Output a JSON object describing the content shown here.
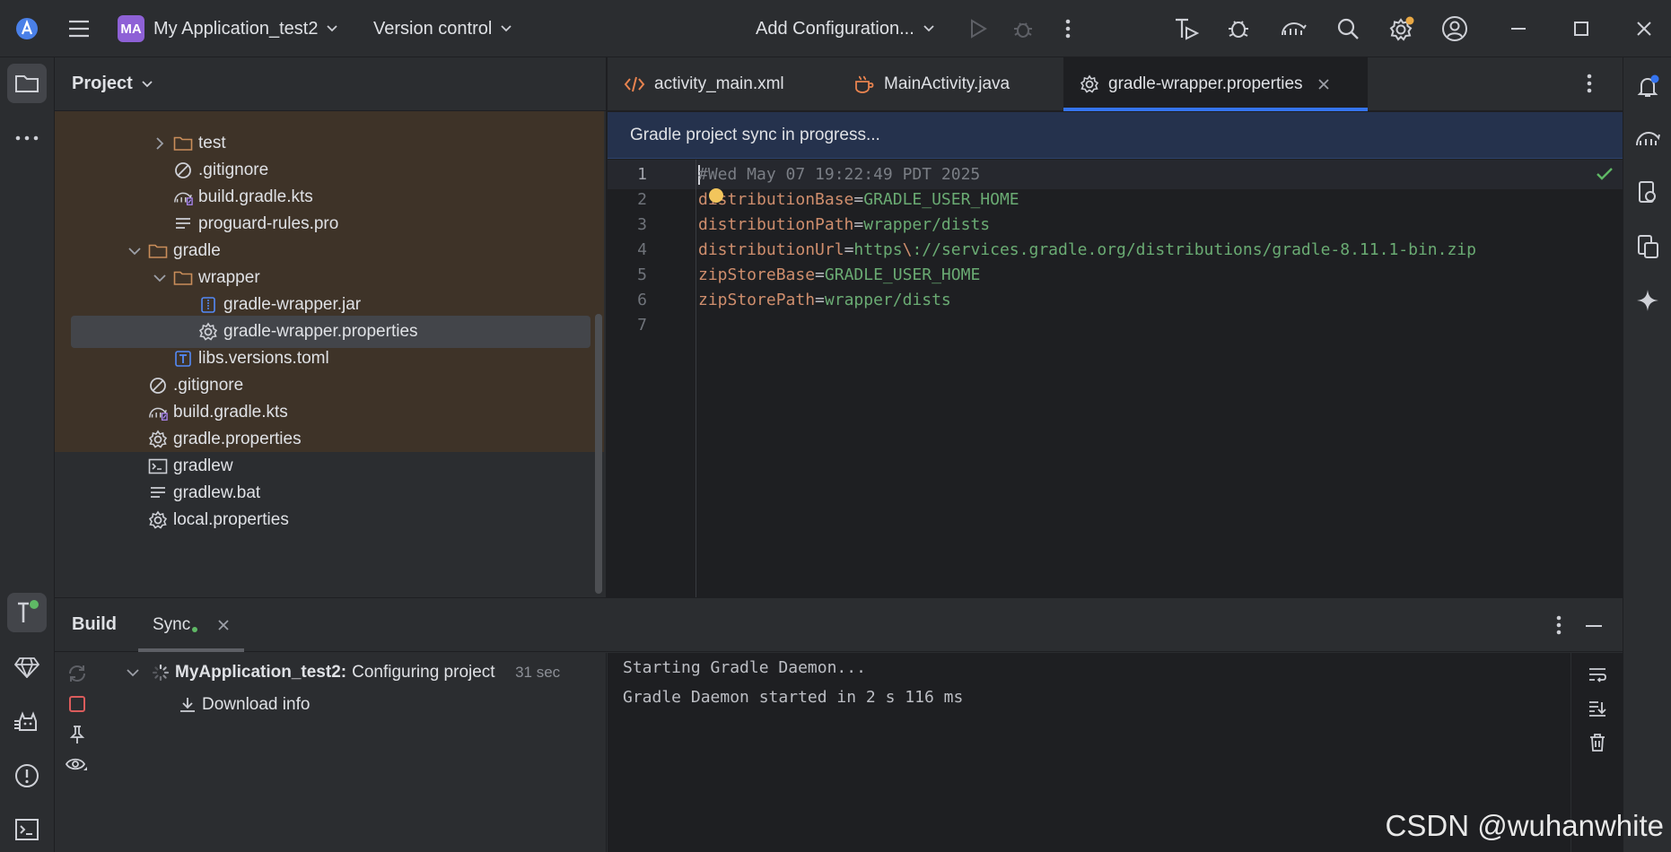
{
  "titlebar": {
    "project_badge": "MA",
    "project_name": "My Application_test2",
    "vcs_label": "Version control",
    "run_config": "Add Configuration..."
  },
  "project_panel": {
    "title": "Project",
    "tree": [
      {
        "label": "test",
        "icon": "folder-icon",
        "expand": "collapsed"
      },
      {
        "label": ".gitignore",
        "icon": "ignore-icon"
      },
      {
        "label": "build.gradle.kts",
        "icon": "gradle-icon"
      },
      {
        "label": "proguard-rules.pro",
        "icon": "text-file-icon"
      },
      {
        "label": "gradle",
        "icon": "folder-icon",
        "expand": "expanded"
      },
      {
        "label": "wrapper",
        "icon": "folder-icon",
        "expand": "expanded"
      },
      {
        "label": "gradle-wrapper.jar",
        "icon": "jar-icon"
      },
      {
        "label": "gradle-wrapper.properties",
        "icon": "settings-file-icon",
        "selected": true
      },
      {
        "label": "libs.versions.toml",
        "icon": "toml-icon"
      },
      {
        "label": ".gitignore",
        "icon": "ignore-icon"
      },
      {
        "label": "build.gradle.kts",
        "icon": "gradle-icon"
      },
      {
        "label": "gradle.properties",
        "icon": "settings-file-icon"
      },
      {
        "label": "gradlew",
        "icon": "terminal-file-icon"
      },
      {
        "label": "gradlew.bat",
        "icon": "text-file-icon"
      },
      {
        "label": "local.properties",
        "icon": "settings-file-icon"
      }
    ]
  },
  "editor": {
    "tabs": [
      {
        "label": "activity_main.xml",
        "icon": "xml-icon"
      },
      {
        "label": "MainActivity.java",
        "icon": "java-icon"
      },
      {
        "label": "gradle-wrapper.properties",
        "icon": "settings-file-icon",
        "active": true
      }
    ],
    "banner": "Gradle project sync in progress...",
    "lines": [
      {
        "num": "1",
        "comment": "#Wed May 07 19:22:49 PDT 2025"
      },
      {
        "num": "2",
        "key": "distributionBase",
        "eq": "=",
        "value": "GRADLE_USER_HOME"
      },
      {
        "num": "3",
        "key": "distributionPath",
        "eq": "=",
        "value": "wrapper/dists"
      },
      {
        "num": "4",
        "key": "distributionUrl",
        "eq": "=",
        "value_a": "https",
        "esc": "\\",
        "value_b": "://services.gradle.org/distributions/gradle-8.11.1-bin.zip"
      },
      {
        "num": "5",
        "key": "zipStoreBase",
        "eq": "=",
        "value": "GRADLE_USER_HOME"
      },
      {
        "num": "6",
        "key": "zipStorePath",
        "eq": "=",
        "value": "wrapper/dists"
      },
      {
        "num": "7"
      }
    ]
  },
  "build_panel": {
    "title": "Build",
    "tab_label": "Sync",
    "task_name": "MyApplication_test2:",
    "task_status": "Configuring project",
    "task_time": "31 sec",
    "child_label": "Download info",
    "console": [
      "Starting Gradle Daemon...",
      "Gradle Daemon started in 2 s 116 ms"
    ]
  },
  "watermark": "CSDN @wuhanwhite",
  "colors": {
    "background": "#1e1f22",
    "panel": "#2b2d30",
    "accent": "#3574f0",
    "badge": "#8e61d6",
    "tree_highlight": "#3e3328",
    "banner": "#25324d",
    "code_key": "#cf8e6d",
    "code_value": "#6aab73",
    "code_comment": "#7a7e85",
    "stop": "#db5c5c",
    "sync_dot": "#5fb865"
  }
}
